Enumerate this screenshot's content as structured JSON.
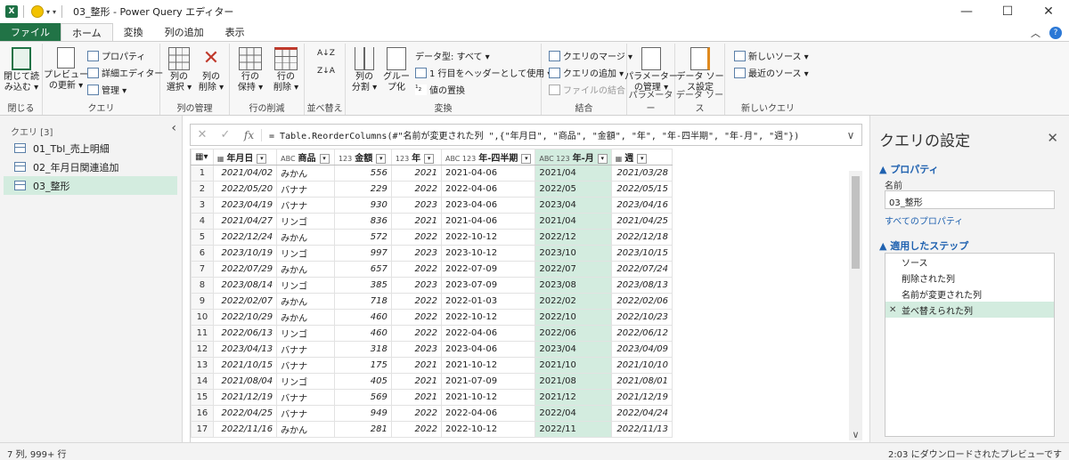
{
  "window": {
    "app_icon": "X",
    "title": "03_整形 - Power Query エディター",
    "minimize": "—",
    "maximize": "☐",
    "close": "✕"
  },
  "menu": {
    "tabs": [
      "ファイル",
      "ホーム",
      "変換",
      "列の追加",
      "表示"
    ],
    "active": "ホーム",
    "collapse": "︿",
    "help": "?"
  },
  "ribbon": {
    "close_group": {
      "btn": "閉じて読\nみ込む ▾",
      "label": "閉じる"
    },
    "query_group": {
      "preview": "プレビュー\nの更新 ▾",
      "properties": "プロパティ",
      "advanced": "詳細エディター",
      "manage": "管理 ▾",
      "label": "クエリ"
    },
    "cols_group": {
      "select": "列の\n選択 ▾",
      "remove": "列の\n削除 ▾",
      "label": "列の管理"
    },
    "rows_group": {
      "keep": "行の\n保持 ▾",
      "remove": "行の\n削除 ▾",
      "label": "行の削減"
    },
    "sort_group": {
      "asc": "A↓Z",
      "desc": "Z↓A",
      "label": "並べ替え"
    },
    "transform_group": {
      "split": "列の\n分割 ▾",
      "group": "グルー\nプ化",
      "datatype": "データ型: すべて ▾",
      "first_row": "1 行目をヘッダーとして使用 ▾",
      "replace": "値の置換",
      "label": "変換"
    },
    "combine_group": {
      "merge": "クエリのマージ ▾",
      "append": "クエリの追加 ▾",
      "files": "ファイルの結合",
      "label": "結合"
    },
    "params_group": {
      "btn": "パラメーター\nの管理 ▾",
      "label": "パラメーター"
    },
    "source_group": {
      "btn": "データ ソー\nス設定",
      "label": "データ ソース"
    },
    "new_group": {
      "new_source": "新しいソース ▾",
      "recent": "最近のソース ▾",
      "label": "新しいクエリ"
    }
  },
  "left_pane": {
    "header": "クエリ [3]",
    "collapse": "‹",
    "queries": [
      "01_Tbl_売上明細",
      "02_年月日関連追加",
      "03_整形"
    ],
    "selected": 2
  },
  "formula_bar": {
    "cancel": "✕",
    "confirm": "✓",
    "fx": "fx",
    "formula": "= Table.ReorderColumns(#\"名前が変更された列 \",{\"年月日\", \"商品\", \"金額\", \"年\", \"年-四半期\", \"年-月\", \"週\"})",
    "dropdown": "∨"
  },
  "grid": {
    "columns": [
      {
        "type": "▦",
        "name": "年月日",
        "width": 88
      },
      {
        "type": "ABC",
        "name": "商品",
        "width": 70
      },
      {
        "type": "123",
        "name": "金額",
        "width": 70
      },
      {
        "type": "123",
        "name": "年",
        "width": 70
      },
      {
        "type": "ABC 123",
        "name": "年-四半期",
        "width": 82
      },
      {
        "type": "ABC 123",
        "name": "年-月",
        "width": 76
      },
      {
        "type": "▦",
        "name": "週",
        "width": 74
      }
    ],
    "selected_col": 5,
    "rows": [
      [
        "2021/04/02",
        "みかん",
        "556",
        "2021",
        "2021-04-06",
        "2021/04",
        "2021/03/28"
      ],
      [
        "2022/05/20",
        "バナナ",
        "229",
        "2022",
        "2022-04-06",
        "2022/05",
        "2022/05/15"
      ],
      [
        "2023/04/19",
        "バナナ",
        "930",
        "2023",
        "2023-04-06",
        "2023/04",
        "2023/04/16"
      ],
      [
        "2021/04/27",
        "リンゴ",
        "836",
        "2021",
        "2021-04-06",
        "2021/04",
        "2021/04/25"
      ],
      [
        "2022/12/24",
        "みかん",
        "572",
        "2022",
        "2022-10-12",
        "2022/12",
        "2022/12/18"
      ],
      [
        "2023/10/19",
        "リンゴ",
        "997",
        "2023",
        "2023-10-12",
        "2023/10",
        "2023/10/15"
      ],
      [
        "2022/07/29",
        "みかん",
        "657",
        "2022",
        "2022-07-09",
        "2022/07",
        "2022/07/24"
      ],
      [
        "2023/08/14",
        "リンゴ",
        "385",
        "2023",
        "2023-07-09",
        "2023/08",
        "2023/08/13"
      ],
      [
        "2022/02/07",
        "みかん",
        "718",
        "2022",
        "2022-01-03",
        "2022/02",
        "2022/02/06"
      ],
      [
        "2022/10/29",
        "みかん",
        "460",
        "2022",
        "2022-10-12",
        "2022/10",
        "2022/10/23"
      ],
      [
        "2022/06/13",
        "リンゴ",
        "460",
        "2022",
        "2022-04-06",
        "2022/06",
        "2022/06/12"
      ],
      [
        "2023/04/13",
        "バナナ",
        "318",
        "2023",
        "2023-04-06",
        "2023/04",
        "2023/04/09"
      ],
      [
        "2021/10/15",
        "バナナ",
        "175",
        "2021",
        "2021-10-12",
        "2021/10",
        "2021/10/10"
      ],
      [
        "2021/08/04",
        "リンゴ",
        "405",
        "2021",
        "2021-07-09",
        "2021/08",
        "2021/08/01"
      ],
      [
        "2021/12/19",
        "バナナ",
        "569",
        "2021",
        "2021-10-12",
        "2021/12",
        "2021/12/19"
      ],
      [
        "2022/04/25",
        "バナナ",
        "949",
        "2022",
        "2022-04-06",
        "2022/04",
        "2022/04/24"
      ],
      [
        "2022/11/16",
        "みかん",
        "281",
        "2022",
        "2022-10-12",
        "2022/11",
        "2022/11/13"
      ]
    ]
  },
  "right_pane": {
    "title": "クエリの設定",
    "close": "✕",
    "properties_header": "▲ プロパティ",
    "name_label": "名前",
    "name_value": "03_整形",
    "all_props": "すべてのプロパティ",
    "steps_header": "▲ 適用したステップ",
    "steps": [
      "ソース",
      "削除された列",
      "名前が変更された列",
      "並べ替えられた列"
    ],
    "selected_step": 3
  },
  "status": {
    "left": "7 列, 999+ 行",
    "right": "2:03 にダウンロードされたプレビューです"
  }
}
